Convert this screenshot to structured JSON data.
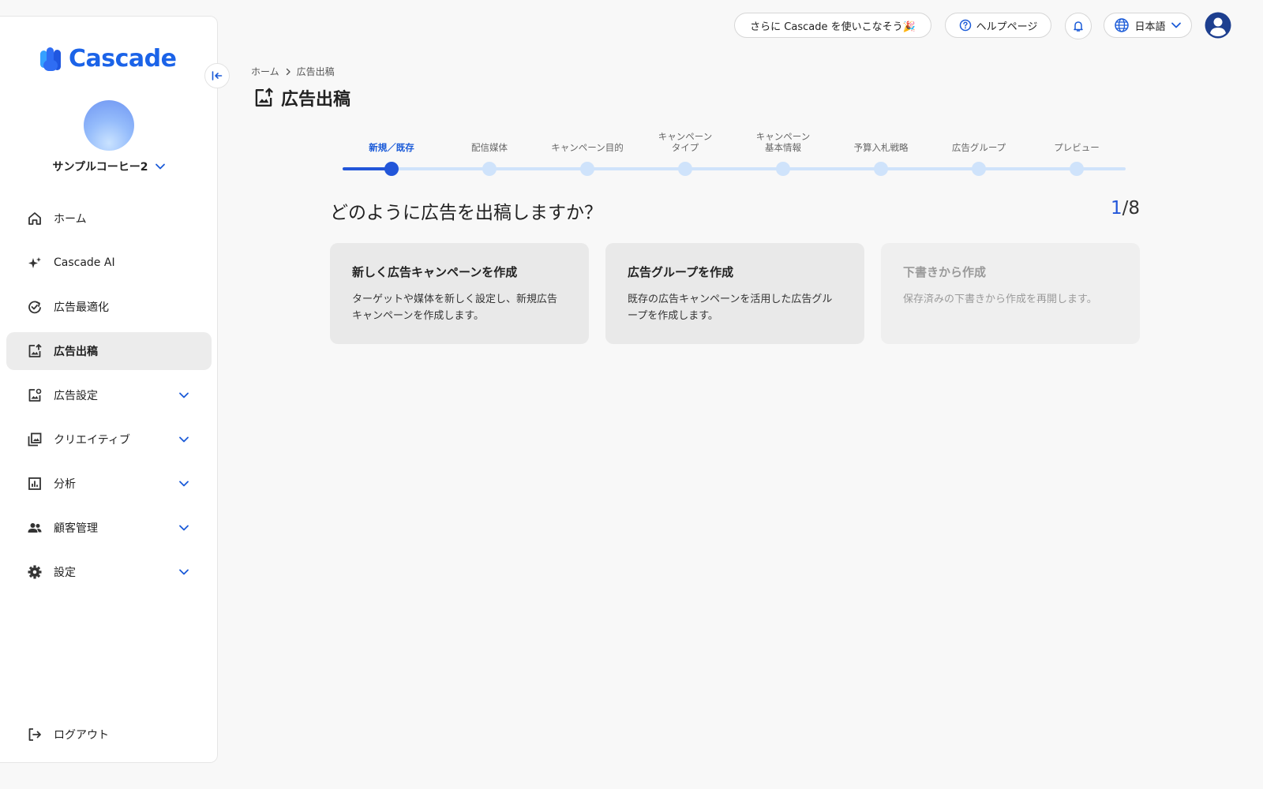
{
  "brand": {
    "name": "Cascade",
    "color": "#1b63e8"
  },
  "account": {
    "name": "サンプルコーヒー2"
  },
  "sidebar": {
    "items": [
      {
        "label": "ホーム",
        "icon": "home-icon",
        "active": false,
        "expandable": false
      },
      {
        "label": "Cascade AI",
        "icon": "sparkle-icon",
        "active": false,
        "expandable": false
      },
      {
        "label": "広告最適化",
        "icon": "refresh-check-icon",
        "active": false,
        "expandable": false
      },
      {
        "label": "広告出稿",
        "icon": "image-upload-icon",
        "active": true,
        "expandable": false
      },
      {
        "label": "広告設定",
        "icon": "ad-settings-icon",
        "active": false,
        "expandable": true
      },
      {
        "label": "クリエイティブ",
        "icon": "gallery-icon",
        "active": false,
        "expandable": true
      },
      {
        "label": "分析",
        "icon": "chart-icon",
        "active": false,
        "expandable": true
      },
      {
        "label": "顧客管理",
        "icon": "people-icon",
        "active": false,
        "expandable": true
      },
      {
        "label": "設定",
        "icon": "gear-icon",
        "active": false,
        "expandable": true
      }
    ],
    "logout_label": "ログアウト"
  },
  "topbar": {
    "promo_label": "さらに Cascade を使いこなそう🎉",
    "help_label": "ヘルプページ",
    "language": "日本語"
  },
  "breadcrumb": {
    "home": "ホーム",
    "current": "広告出稿"
  },
  "page_title": "広告出稿",
  "stepper": {
    "current_index": 0,
    "steps": [
      {
        "line1": "新規／既存",
        "line2": ""
      },
      {
        "line1": "配信媒体",
        "line2": ""
      },
      {
        "line1": "キャンペーン目的",
        "line2": ""
      },
      {
        "line1": "キャンペーン",
        "line2": "タイプ"
      },
      {
        "line1": "キャンペーン",
        "line2": "基本情報"
      },
      {
        "line1": "予算入札戦略",
        "line2": ""
      },
      {
        "line1": "広告グループ",
        "line2": ""
      },
      {
        "line1": "プレビュー",
        "line2": ""
      }
    ]
  },
  "question": "どのように広告を出稿しますか？",
  "progress": {
    "current": "1",
    "total": "/8"
  },
  "options": [
    {
      "title": "新しく広告キャンペーンを作成",
      "desc": "ターゲットや媒体を新しく設定し、新規広告キャンペーンを作成します。",
      "disabled": false
    },
    {
      "title": "広告グループを作成",
      "desc": "既存の広告キャンペーンを活用した広告グループを作成します。",
      "disabled": false
    },
    {
      "title": "下書きから作成",
      "desc": "保存済みの下書きから作成を再開します。",
      "disabled": true
    }
  ],
  "colors": {
    "accent": "#2256d9",
    "step_track": "#cfe3fb",
    "active_nav_bg": "#ececec",
    "card_bg": "#e9e9e9"
  }
}
